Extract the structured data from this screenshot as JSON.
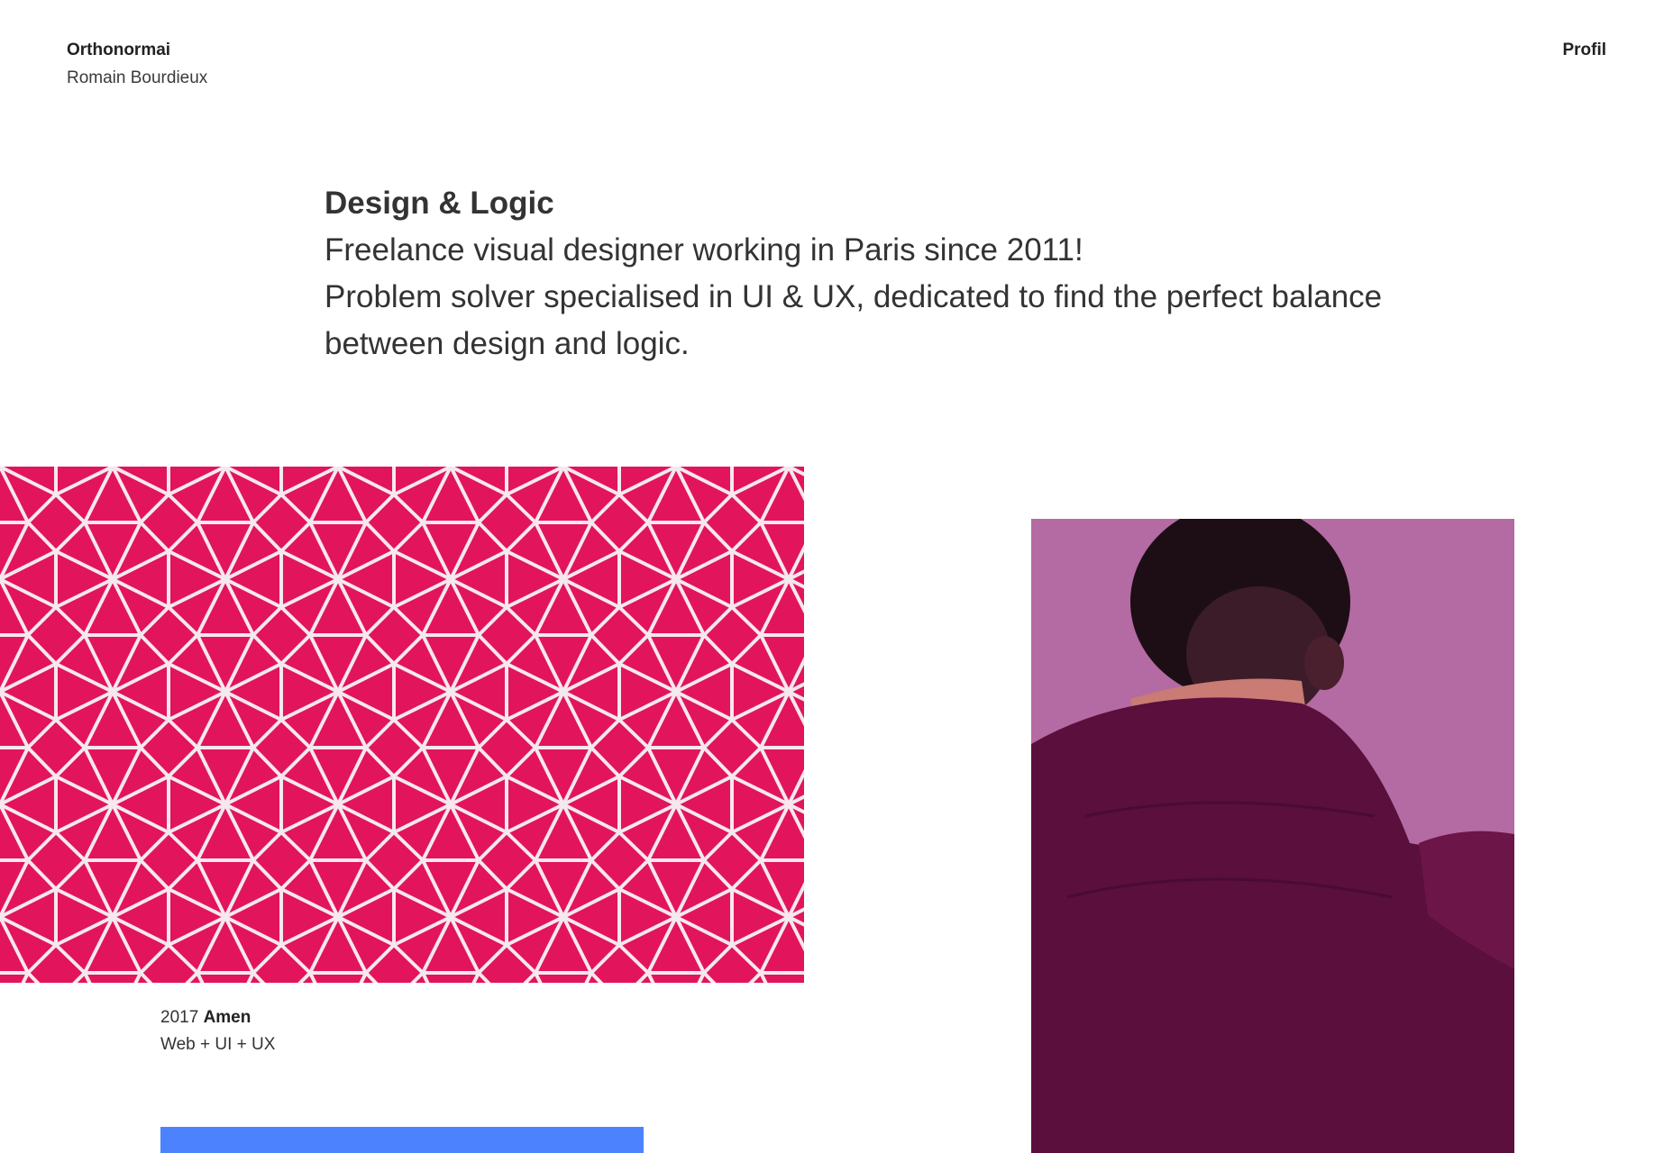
{
  "header": {
    "brand_name": "Orthonormai",
    "owner_name": "Romain Bourdieux",
    "nav_profil": "Profil"
  },
  "intro": {
    "headline": "Design & Logic",
    "line1": "Freelance visual designer working in Paris since 2011!",
    "line2": "Problem solver specialised in UI & UX, dedicated to find the perfect balance",
    "line3": "between design and logic."
  },
  "projects": [
    {
      "year": "2017",
      "title": "Amen",
      "tags": "Web + UI + UX",
      "image": "pink-geometric-pattern",
      "color": "#e2145c"
    },
    {
      "image": "man-in-purple-jacket-photo",
      "color": "#b46aa3"
    },
    {
      "image": "blue-block",
      "color": "#4d82ff"
    }
  ],
  "colors": {
    "text": "#2b2b2b",
    "background": "#ffffff",
    "pink": "#e2145c",
    "purple": "#b46aa3",
    "blue": "#4d82ff"
  }
}
